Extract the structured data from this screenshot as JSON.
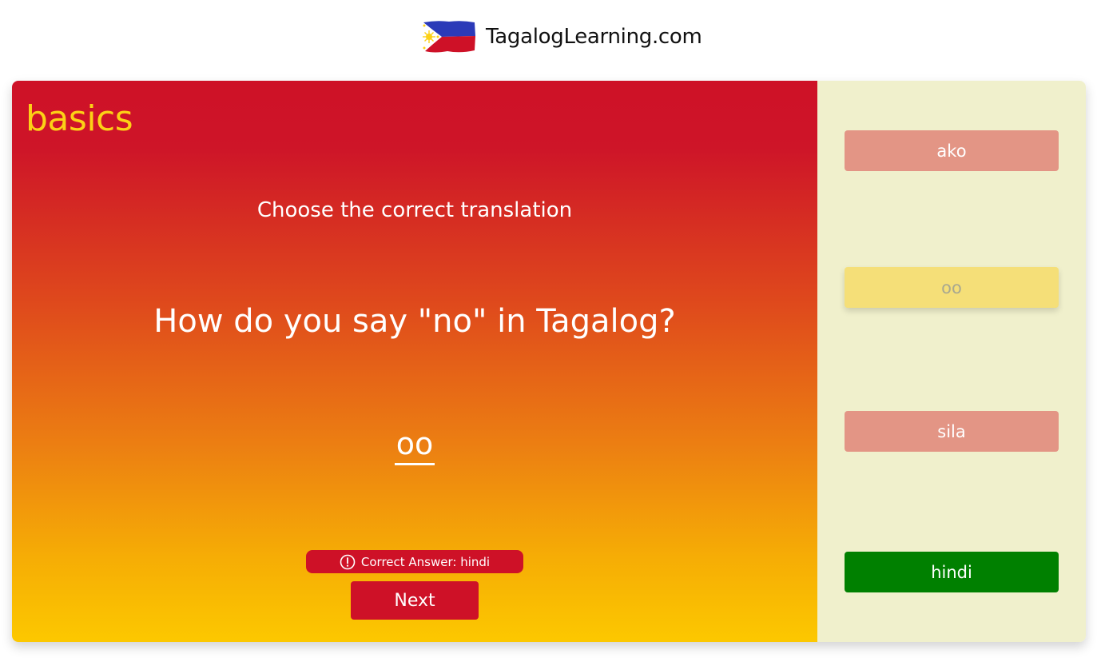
{
  "header": {
    "site_name": "TagalogLearning.com",
    "flag_icon": "philippines-flag-icon"
  },
  "lesson": {
    "category": "basics",
    "instruction": "Choose the correct translation",
    "question": "How do you say \"no\" in Tagalog?",
    "selected_answer": "oo",
    "feedback": "Correct Answer: hindi",
    "next_label": "Next"
  },
  "options": [
    {
      "label": "ako",
      "state": "wrong"
    },
    {
      "label": "oo",
      "state": "selected"
    },
    {
      "label": "sila",
      "state": "wrong"
    },
    {
      "label": "hindi",
      "state": "correct"
    }
  ],
  "colors": {
    "red": "#ce1127",
    "yellow": "#fcd116",
    "blue": "#0038a8",
    "correct_green": "#008000",
    "wrong_salmon": "#e39585",
    "selected_yellow": "#f5df78",
    "panel_bg": "#f0f0cc"
  }
}
